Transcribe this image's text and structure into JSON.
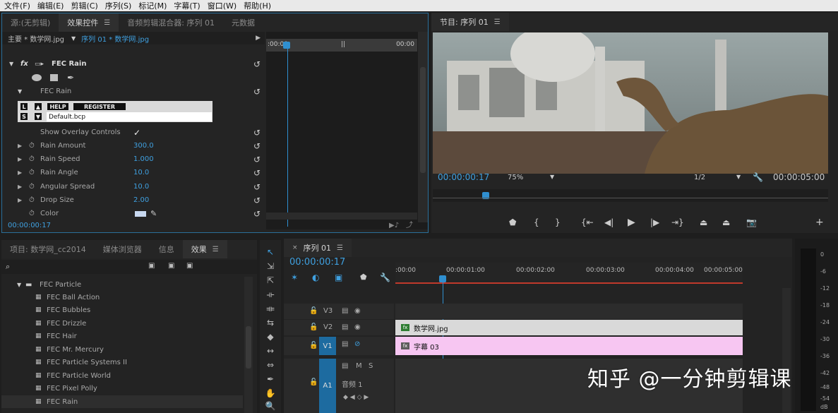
{
  "menu": [
    "文件(F)",
    "编辑(E)",
    "剪辑(C)",
    "序列(S)",
    "标记(M)",
    "字幕(T)",
    "窗口(W)",
    "帮助(H)"
  ],
  "ec": {
    "tabs": [
      "源:(无剪辑)",
      "效果控件",
      "音频剪辑混合器: 序列 01",
      "元数据"
    ],
    "header": {
      "master": "主要 * 数学网.jpg",
      "seq": "序列 01 * 数学网.jpg"
    },
    "ruler": {
      "start": ":00:00",
      "end": "00:00"
    },
    "effect_name": "FEC Rain",
    "effect_sub": "FEC Rain",
    "help": "HELP",
    "register": "REGISTER",
    "l": "L",
    "s": "S",
    "preset": "Default.bcp",
    "overlay_label": "Show Overlay Controls",
    "overlay_check": "✓",
    "params": [
      {
        "label": "Rain Amount",
        "value": "300.0"
      },
      {
        "label": "Rain Speed",
        "value": "1.000"
      },
      {
        "label": "Rain Angle",
        "value": "10.0"
      },
      {
        "label": "Angular Spread",
        "value": "10.0"
      },
      {
        "label": "Drop Size",
        "value": "2.00"
      },
      {
        "label": "Color",
        "value": ""
      }
    ],
    "time": "00:00:00:17",
    "color_swatch": "#c8d8f0"
  },
  "pm": {
    "title": "节目: 序列 01",
    "timecode": "00:00:00:17",
    "zoom": "75%",
    "quality": "1/2",
    "duration": "00:00:05:00"
  },
  "proj": {
    "tabs": [
      "项目: 数学网_cc2014",
      "媒体浏览器",
      "信息",
      "效果"
    ],
    "folder": "FEC Particle",
    "items": [
      "FEC Ball Action",
      "FEC Bubbles",
      "FEC Drizzle",
      "FEC Hair",
      "FEC Mr. Mercury",
      "FEC Particle Systems II",
      "FEC Particle World",
      "FEC Pixel Polly",
      "FEC Rain"
    ]
  },
  "tl": {
    "tab": "序列 01",
    "timecode": "00:00:00:17",
    "ruler": [
      ":00:00",
      "00:00:01:00",
      "00:00:02:00",
      "00:00:03:00",
      "00:00:04:00",
      "00:00:05:00"
    ],
    "tracks": [
      {
        "name": "V3"
      },
      {
        "name": "V2"
      },
      {
        "name": "V1"
      }
    ],
    "audio": {
      "name": "A1",
      "label": "音频 1",
      "m": "M",
      "s": "S"
    },
    "clip_v2": "数学网.jpg",
    "clip_v1": "字幕 03"
  },
  "meter": [
    "0",
    "-6",
    "-12",
    "-18",
    "-24",
    "-30",
    "-36",
    "-42",
    "-48",
    "-54",
    "dB"
  ],
  "watermark": "知乎 @一分钟剪辑课",
  "colors": {
    "accent": "#2f8fd0",
    "title_clip": "#f7c6f2",
    "img_clip": "#d9d9d9"
  }
}
